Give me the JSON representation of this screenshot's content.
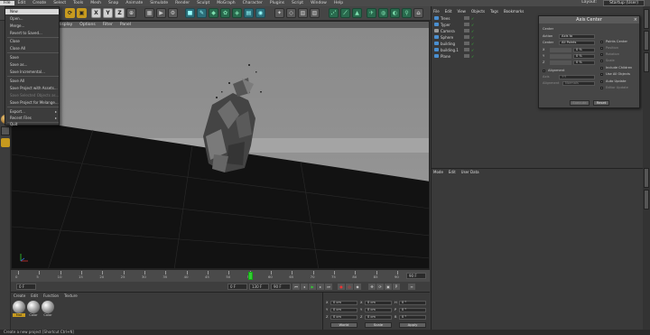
{
  "menubar": {
    "items": [
      "File",
      "Edit",
      "Create",
      "Select",
      "Tools",
      "Mesh",
      "Snap",
      "Animate",
      "Simulate",
      "Render",
      "Sculpt",
      "MoGraph",
      "Character",
      "Plugins",
      "Script",
      "Window",
      "Help"
    ],
    "layout_label": "Layout:",
    "layout_value": "Startup (User)"
  },
  "toolbar": {
    "x_label": "X",
    "y_label": "Y",
    "z_label": "Z"
  },
  "viewport": {
    "menu": [
      "View",
      "Cameras",
      "Display",
      "Options",
      "Filter",
      "Panel"
    ]
  },
  "file_menu": {
    "items": [
      {
        "label": "New",
        "state": "highlight"
      },
      {
        "label": "Open...",
        "state": "normal"
      },
      {
        "label": "Merge...",
        "state": "normal"
      },
      {
        "label": "Revert to Saved...",
        "state": "normal"
      },
      {
        "label": "Close",
        "state": "normal"
      },
      {
        "label": "Close All",
        "state": "normal"
      },
      {
        "label": "Save",
        "state": "normal"
      },
      {
        "label": "Save as...",
        "state": "normal"
      },
      {
        "label": "Save Incremental...",
        "state": "normal"
      },
      {
        "label": "Save All",
        "state": "normal"
      },
      {
        "label": "Save Project with Assets...",
        "state": "normal"
      },
      {
        "label": "Save Selected Objects as...",
        "state": "disabled"
      },
      {
        "label": "Save Project for Melange...",
        "state": "normal"
      },
      {
        "label": "Export...",
        "state": "normal"
      },
      {
        "label": "Recent Files",
        "state": "normal"
      },
      {
        "label": "Quit",
        "state": "normal"
      }
    ]
  },
  "timeline": {
    "ticks": [
      "0",
      "5",
      "10",
      "15",
      "20",
      "25",
      "30",
      "35",
      "40",
      "45",
      "50",
      "55",
      "60",
      "65",
      "70",
      "75",
      "80",
      "85",
      "90"
    ],
    "current_frame": "90 F",
    "start": "0 F",
    "end": "90 F",
    "preview_min": "0 F",
    "preview_max": "130 F",
    "playhead_frame": 55
  },
  "materials": {
    "menu": [
      "Create",
      "Edit",
      "Function",
      "Texture"
    ],
    "swatches": [
      "Mat",
      "Color",
      "Color"
    ]
  },
  "coordinates": {
    "rows": [
      {
        "label": "X",
        "pos": "0 cm",
        "size": "0 cm",
        "rot_label": "H",
        "rot": "0 °"
      },
      {
        "label": "Y",
        "pos": "0 cm",
        "size": "0 cm",
        "rot_label": "P",
        "rot": "0 °"
      },
      {
        "label": "Z",
        "pos": "0 cm",
        "size": "0 cm",
        "rot_label": "B",
        "rot": "0 °"
      }
    ],
    "mode_world": "World",
    "mode_scale": "Scale",
    "apply_label": "Apply"
  },
  "status_bar": {
    "text": "Create a new project [Shortcut Ctrl+N]"
  },
  "objects_panel": {
    "menu": [
      "File",
      "Edit",
      "View",
      "Objects",
      "Tags",
      "Bookmarks"
    ],
    "items": [
      {
        "name": "Trees",
        "color": "#4a8fd0"
      },
      {
        "name": "Typer",
        "color": "#4a8fd0"
      },
      {
        "name": "Camera",
        "color": "#9a9a9a"
      },
      {
        "name": "Sphere",
        "color": "#4a8fd0"
      },
      {
        "name": "building",
        "color": "#4a8fd0"
      },
      {
        "name": "building.1",
        "color": "#4a8fd0"
      },
      {
        "name": "Plane",
        "color": "#4a8fd0"
      }
    ]
  },
  "axis_center_dialog": {
    "title": "Axis Center",
    "section": "Center",
    "action_label": "Action",
    "action_value": "Axis to",
    "center_label": "Center",
    "center_value": "All Points",
    "x_label": "X",
    "x_value": "0 %",
    "y_label": "Y",
    "y_value": "0 %",
    "z_label": "Z",
    "z_value": "0 %",
    "alignment_check": "Alignment",
    "axis_label": "Axis",
    "axis_value": "+Y",
    "alignment_label": "Alignment",
    "alignment_value": "Normals",
    "points_center": "Points Center",
    "position": "Position",
    "rotation": "Rotation",
    "scale": "Scale",
    "include_children": "Include Children",
    "use_all_objects": "Use All Objects",
    "auto_update": "Auto Update",
    "editor_update": "Editor Update",
    "execute_label": "Execute",
    "reset_label": "Reset"
  },
  "attributes_panel": {
    "menu": [
      "Mode",
      "Edit",
      "User Data"
    ]
  }
}
